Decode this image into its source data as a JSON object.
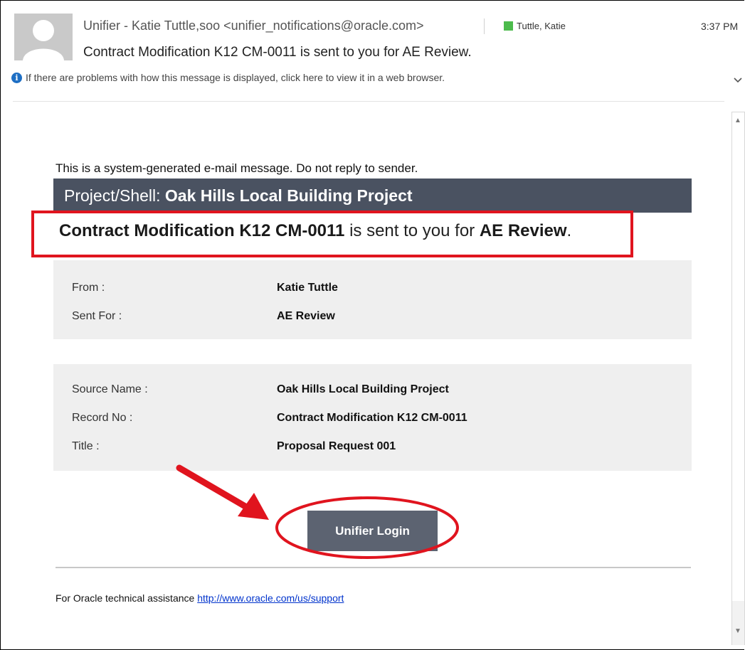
{
  "header": {
    "sender": "Unifier - Katie Tuttle,soo <unifier_notifications@oracle.com>",
    "category_tag": "Tuttle, Katie",
    "time": "3:37 PM",
    "subject": "Contract Modification K12 CM-0011 is sent to you for AE Review.",
    "info_bar": "If there are problems with how this message is displayed, click here to view it in a web browser."
  },
  "body": {
    "system_message": "This is a system-generated e-mail message. Do not reply to sender.",
    "project_label": "Project/Shell: ",
    "project_name": "Oak Hills Local Building Project",
    "headline": {
      "record": "Contract Modification K12 CM-0011",
      "middle": " is sent to you for ",
      "action": "AE Review",
      "end": "."
    },
    "panel1": {
      "from_label": "From :",
      "from_value": "Katie Tuttle",
      "sent_for_label": "Sent For :",
      "sent_for_value": "AE Review"
    },
    "panel2": {
      "source_label": "Source Name :",
      "source_value": "Oak Hills Local Building Project",
      "record_label": "Record No :",
      "record_value": "Contract Modification K12 CM-0011",
      "title_label": "Title :",
      "title_value": "Proposal Request 001"
    },
    "login_button": "Unifier Login",
    "footer_text": "For Oracle technical assistance ",
    "footer_link": "http://www.oracle.com/us/support"
  },
  "colors": {
    "project_bar": "#4a5261",
    "button": "#5c6371",
    "annotation_red": "#e0141e",
    "category_green": "#4cbb4c",
    "link_blue": "#0033cc"
  },
  "icons": [
    "avatar-placeholder-icon",
    "info-icon",
    "chevron-down-icon",
    "scroll-up-icon",
    "scroll-down-icon"
  ]
}
